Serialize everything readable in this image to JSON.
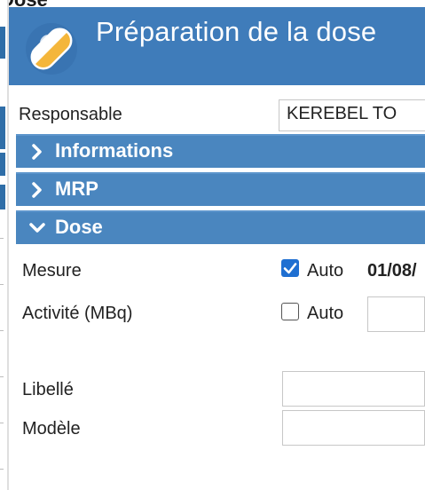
{
  "background": {
    "title_fragment": "Dose"
  },
  "dialog": {
    "title": "Préparation de la dose",
    "icon": "pill-capsule-icon",
    "responsable": {
      "label": "Responsable",
      "value": "KEREBEL TO"
    },
    "sections": {
      "informations": {
        "label": "Informations",
        "state": "collapsed"
      },
      "mrp": {
        "label": "MRP",
        "state": "collapsed"
      },
      "dose": {
        "label": "Dose",
        "state": "expanded"
      }
    },
    "dose_fields": {
      "mesure": {
        "label": "Mesure",
        "auto_label": "Auto",
        "auto_checked": true,
        "value": "01/08/"
      },
      "activite": {
        "label": "Activité (MBq)",
        "auto_label": "Auto",
        "auto_checked": false,
        "value": ""
      },
      "libelle": {
        "label": "Libellé",
        "value": ""
      },
      "modele": {
        "label": "Modèle",
        "value": ""
      }
    }
  },
  "colors": {
    "header_bg": "#3f7cba",
    "section_bg": "#4a86bf",
    "checkbox_checked": "#1f6fd1"
  }
}
